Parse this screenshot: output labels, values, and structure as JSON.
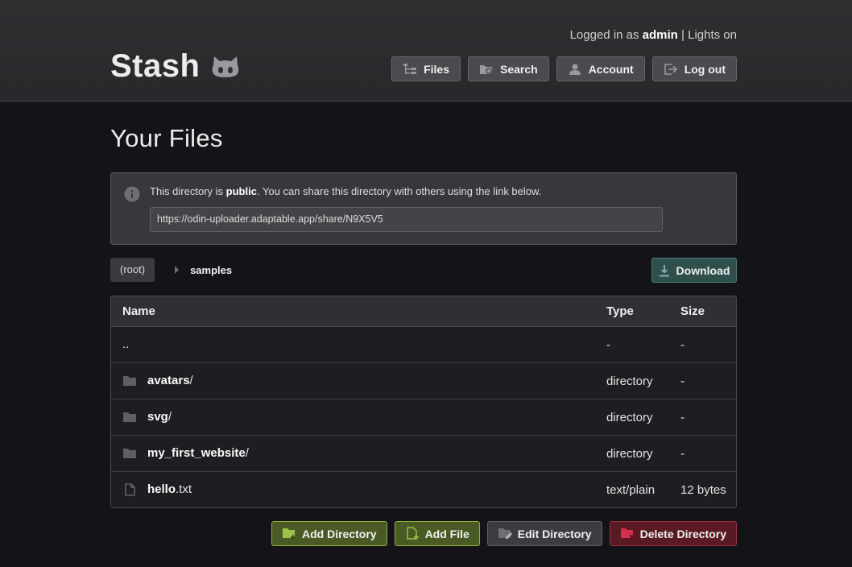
{
  "header": {
    "logo_text": "Stash",
    "login_prefix": "Logged in as",
    "username": "admin",
    "separator": "|",
    "lights_label": "Lights on",
    "nav": [
      {
        "label": "Files",
        "icon": "tree-icon"
      },
      {
        "label": "Search",
        "icon": "folder-search-icon"
      },
      {
        "label": "Account",
        "icon": "user-icon"
      },
      {
        "label": "Log out",
        "icon": "logout-icon"
      }
    ]
  },
  "main": {
    "title": "Your Files",
    "info": {
      "text_before": "This directory is ",
      "visibility": "public",
      "text_after": ". You can share this directory with others using the link below.",
      "share_url": "https://odin-uploader.adaptable.app/share/N9X5V5"
    },
    "breadcrumb": {
      "root": "(root)",
      "current": "samples"
    },
    "download_label": "Download",
    "table": {
      "headers": {
        "name": "Name",
        "type": "Type",
        "size": "Size"
      },
      "rows": [
        {
          "name": "..",
          "ext": "",
          "type": "-",
          "size": "-",
          "icon": ""
        },
        {
          "name": "avatars",
          "ext": "/",
          "type": "directory",
          "size": "-",
          "icon": "folder-icon"
        },
        {
          "name": "svg",
          "ext": "/",
          "type": "directory",
          "size": "-",
          "icon": "folder-icon"
        },
        {
          "name": "my_first_website",
          "ext": "/",
          "type": "directory",
          "size": "-",
          "icon": "folder-icon"
        },
        {
          "name": "hello",
          "ext": ".txt",
          "type": "text/plain",
          "size": "12 bytes",
          "icon": "file-icon"
        }
      ]
    },
    "actions": {
      "add_directory": "Add Directory",
      "add_file": "Add File",
      "edit_directory": "Edit Directory",
      "delete_directory": "Delete Directory"
    }
  },
  "colors": {
    "background": "#141418",
    "header": "#2c2c2f",
    "accent_green": "#8fae3c",
    "accent_teal": "#4f7a76",
    "accent_red": "#9b2f44"
  }
}
